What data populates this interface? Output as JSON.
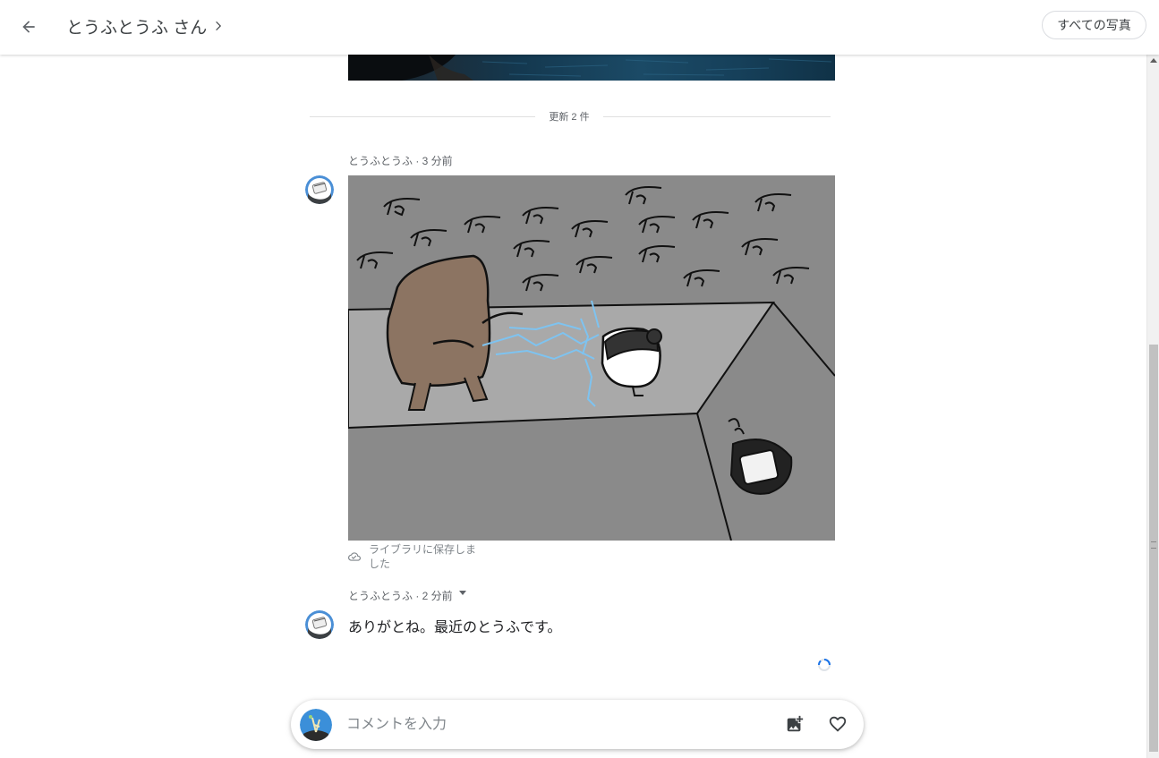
{
  "header": {
    "title": "とうふとうふ さん",
    "all_photos_label": "すべての写真"
  },
  "feed": {
    "divider_label": "更新 2 件",
    "posts": [
      {
        "author": "とうふとうふ",
        "time": "3 分前",
        "meta": "とうふとうふ · 3 分前",
        "saved_status": "ライブラリに保存しました"
      },
      {
        "author": "とうふとうふ",
        "time": "2 分前",
        "meta": "とうふとうふ · 2 分前",
        "message": "ありがとね。最近のとうふです。"
      }
    ]
  },
  "composer": {
    "placeholder": "コメントを入力"
  },
  "icons": {
    "back": "arrow-back-icon",
    "title_chevron": "chevron-right-icon",
    "saved": "cloud-done-icon",
    "add_photo": "add-photo-icon",
    "like": "heart-outline-icon",
    "loading": "spinner-icon"
  },
  "colors": {
    "accent": "#1a73e8",
    "text_primary": "#202124",
    "text_secondary": "#5f6368"
  }
}
